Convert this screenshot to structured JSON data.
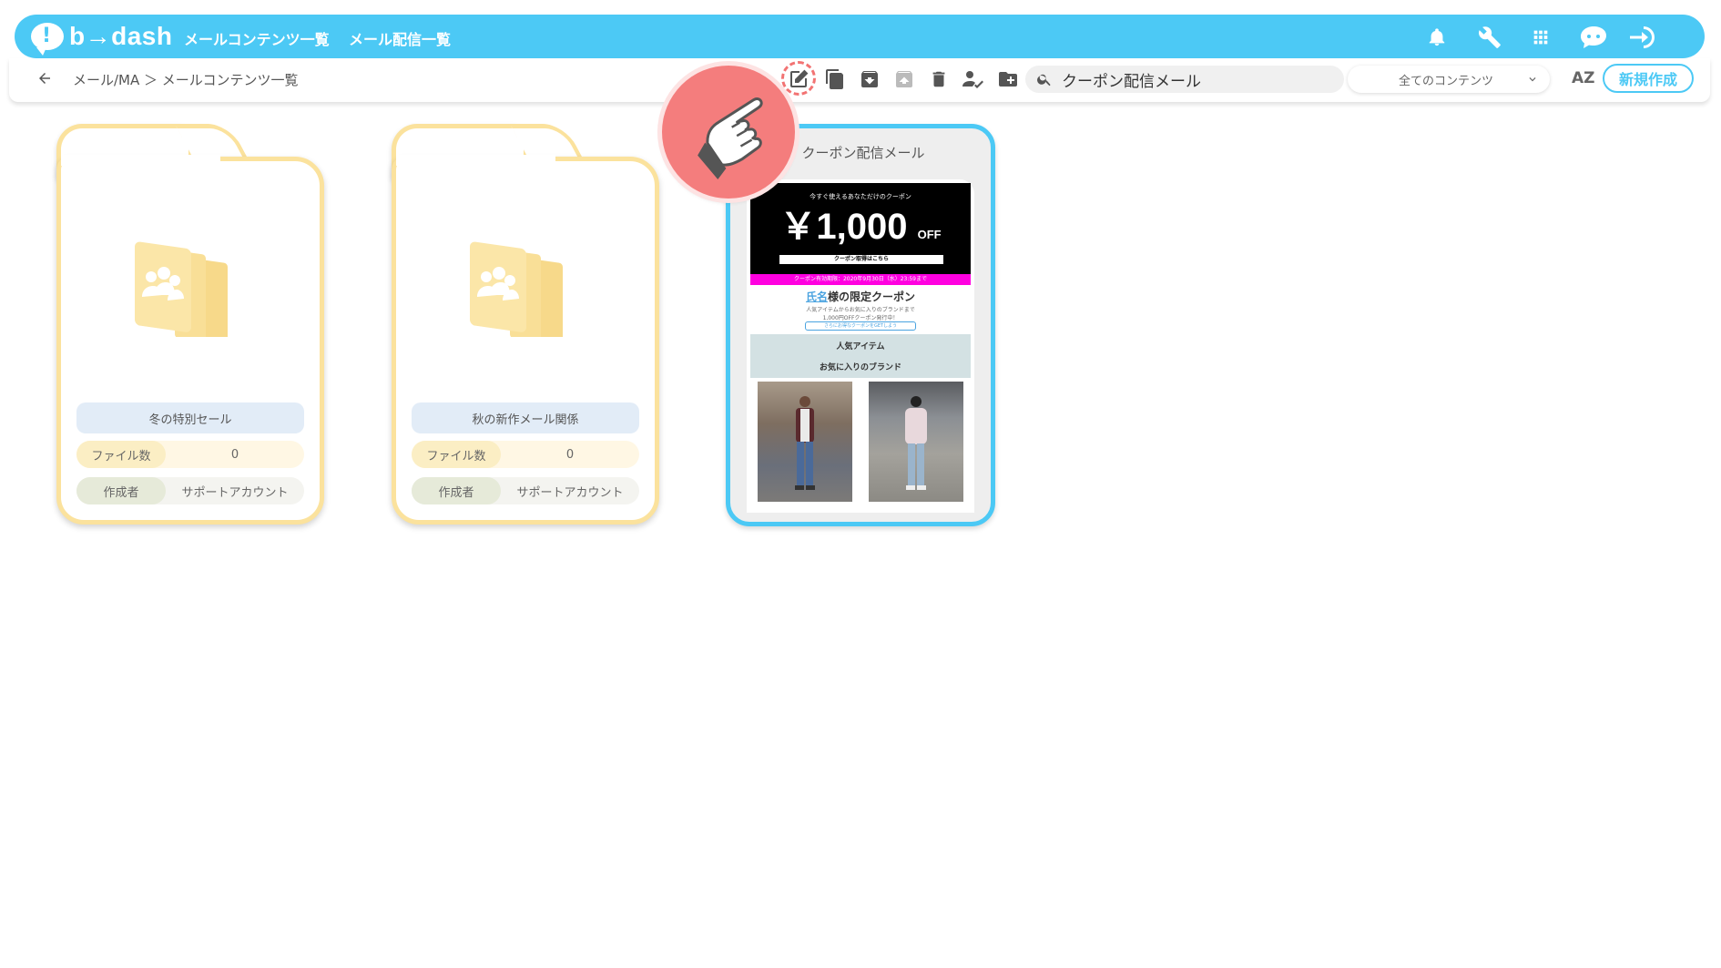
{
  "app": {
    "logo_text": "b→dash",
    "brand_color": "#4cc9f5"
  },
  "nav": {
    "links": [
      {
        "label": "メールコンテンツ一覧"
      },
      {
        "label": "メール配信一覧"
      }
    ],
    "icons": [
      "bell-icon",
      "wrench-icon",
      "apps-grid-icon",
      "support-chat-icon",
      "logout-icon"
    ]
  },
  "subbar": {
    "breadcrumb": "メール/MA ＞ メールコンテンツ一覧",
    "toolbar_icons": [
      "edit-icon",
      "copy-icon",
      "archive-icon",
      "unarchive-icon",
      "trash-icon",
      "assign-user-icon",
      "add-folder-icon"
    ],
    "search": {
      "value": "クーポン配信メール",
      "placeholder": ""
    },
    "filter_select": {
      "selected": "全てのコンテンツ"
    },
    "sort_label": "AZ",
    "new_button": "新規作成"
  },
  "folders": [
    {
      "name": "冬の特別セール",
      "file_count_label": "ファイル数",
      "file_count": "0",
      "author_label": "作成者",
      "author": "サポートアカウント"
    },
    {
      "name": "秋の新作メール関係",
      "file_count_label": "ファイル数",
      "file_count": "0",
      "author_label": "作成者",
      "author": "サポートアカウント"
    }
  ],
  "mail_card": {
    "title": "クーポン配信メール",
    "preview": {
      "headline": "今すぐ使えるあなただけのクーポン",
      "price": "￥1,000",
      "off": "OFF",
      "cta": "クーポン取得はこちら",
      "period": "クーポン有効期限：2020年9月30日（水）23:59まで",
      "name_placeholder": "氏名",
      "heading_suffix": "様の限定クーポン",
      "line1": "人気アイテムからお気に入りのブランドまで",
      "line2": "1,000円OFFクーポン発行中！",
      "mini_button": "さらにお得なクーポンをGETしよう",
      "section1": "人気アイテム",
      "section2": "お気に入りのブランド"
    }
  }
}
